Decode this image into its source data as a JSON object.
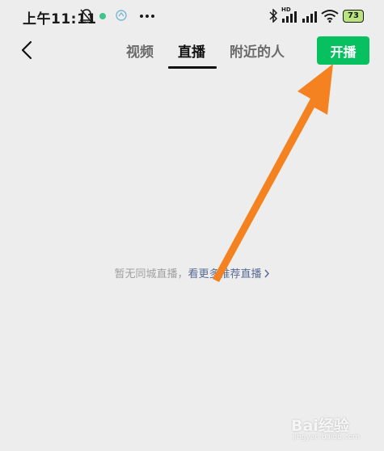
{
  "status_bar": {
    "time": "上午11:11",
    "battery": "73",
    "signal_badge": "HD",
    "icons": [
      "bell-off-icon",
      "green-dot-icon",
      "app-notification-icon",
      "more-dots-icon",
      "bluetooth-icon",
      "signal-icon",
      "wifi-icon",
      "battery-icon"
    ]
  },
  "nav": {
    "tabs": [
      "视频",
      "直播",
      "附近的人"
    ],
    "active_tab": "直播",
    "start_live_label": "开播",
    "back_icon": "back-chevron-icon"
  },
  "main": {
    "empty_text": "暂无同城直播，",
    "link_text": "看更多推荐直播",
    "link_icon": "chevron-right-icon"
  },
  "annotation": {
    "arrow_color": "#f58220"
  },
  "watermark": {
    "text": "Bai经验",
    "subtext": "jingyan.baidu.com"
  },
  "colors": {
    "background": "#ededed",
    "accent_green": "#07c160",
    "link_blue": "#576b95",
    "muted_text": "#a0a0a0"
  }
}
